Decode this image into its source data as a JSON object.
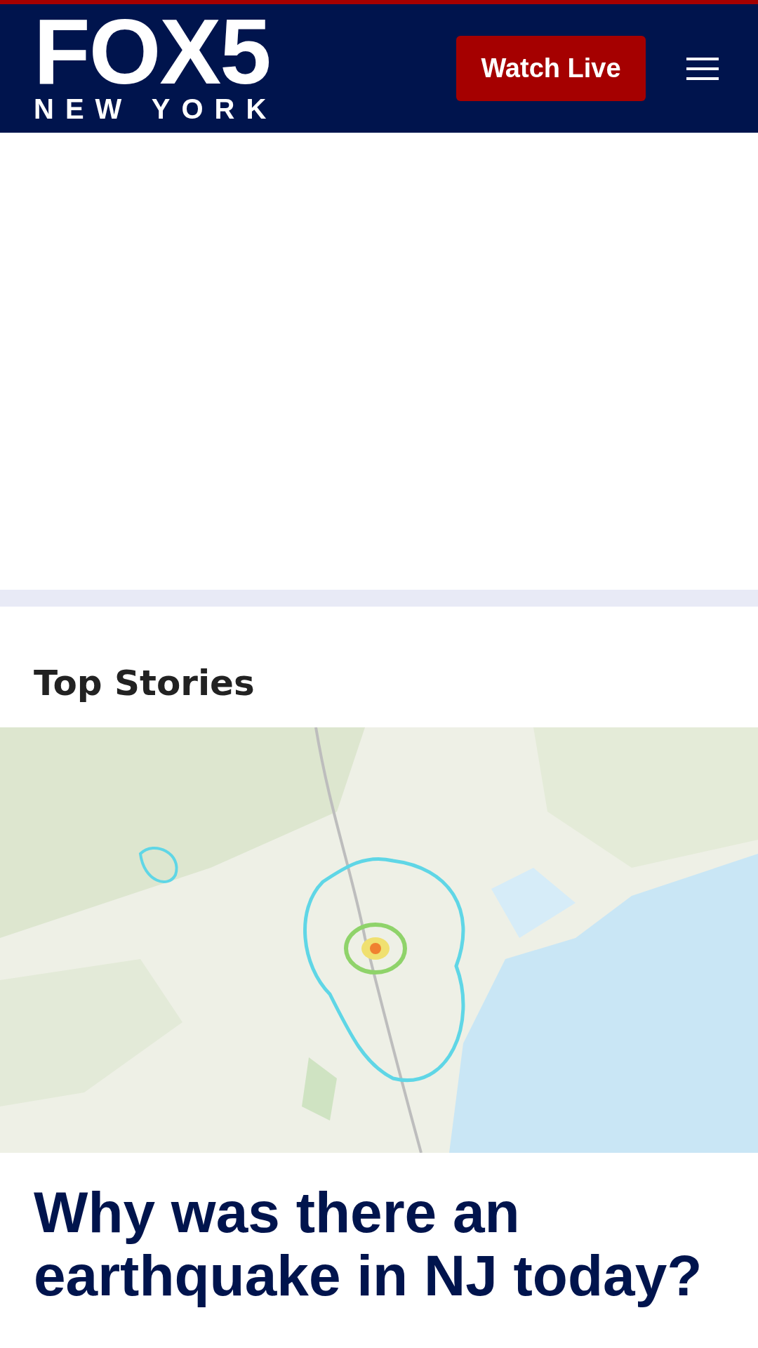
{
  "header": {
    "logo": {
      "main": "FOX5",
      "sub": "NEW YORK"
    },
    "watch_live_button": "Watch Live"
  },
  "section_title": "Top Stories",
  "top_story": {
    "headline": "Why was there an earthquake in NJ today?"
  }
}
